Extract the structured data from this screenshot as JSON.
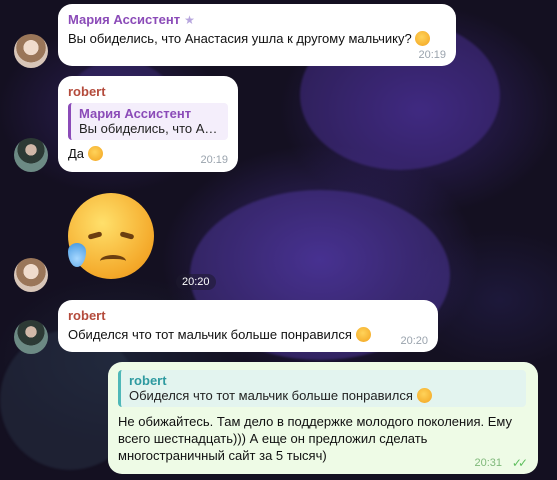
{
  "messages": {
    "m1": {
      "sender": "Мария Ассистент",
      "text": "Вы обиделись, что Анастасия ушла к другому мальчику?",
      "time": "20:19"
    },
    "m2": {
      "sender": "robert",
      "reply_name": "Мария Ассистент",
      "reply_text": "Вы обиделись, что Ан...",
      "text": "Да",
      "time": "20:19"
    },
    "m3": {
      "time": "20:20"
    },
    "m4": {
      "sender": "robert",
      "text": "Обиделся что тот мальчик больше понравился",
      "time": "20:20"
    },
    "m5": {
      "reply_name": "robert",
      "reply_text": "Обиделся что тот мальчик больше понравился",
      "text": "Не обижайтесь. Там дело в поддержке молодого поколения. Ему всего шестнадцать))) А еще он предложил сделать многостраничный сайт за 5 тысяч)",
      "time": "20:31"
    }
  },
  "icons": {
    "star": "★",
    "read_checks": "✓✓"
  }
}
